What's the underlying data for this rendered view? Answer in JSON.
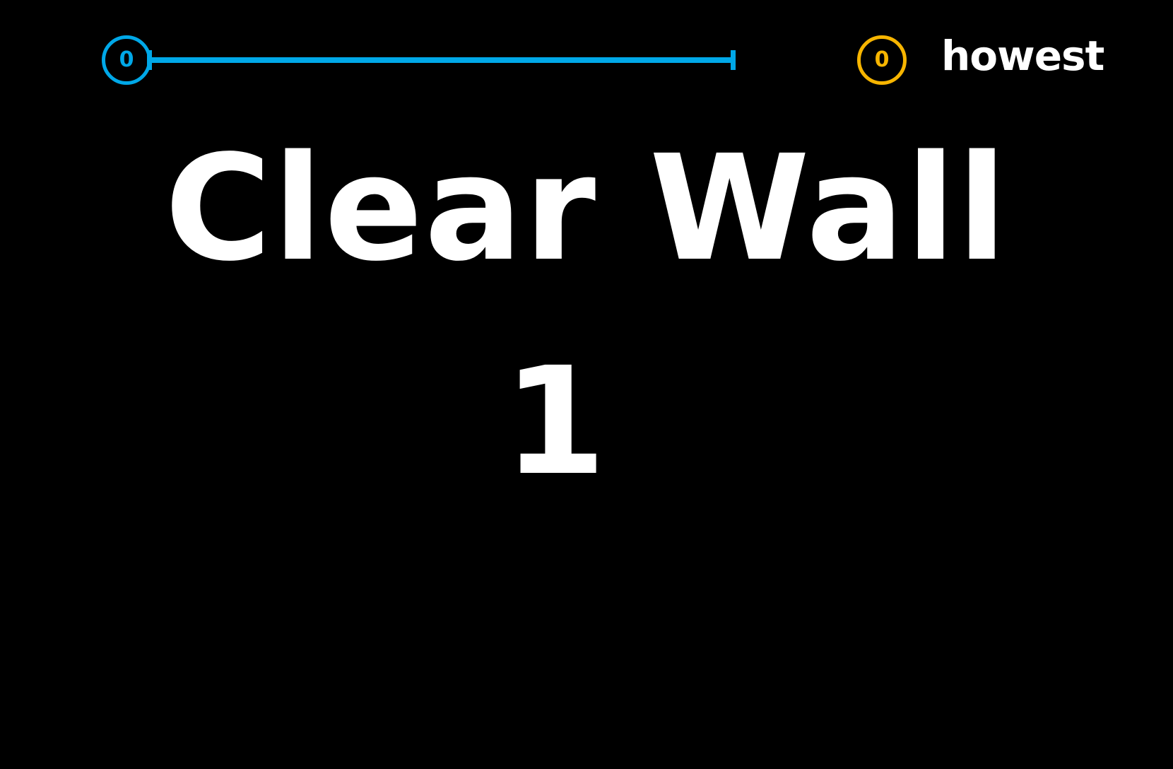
{
  "hud": {
    "player1_score": "0",
    "player2_score": "0",
    "brand": "howest",
    "timer_remaining": 1.0
  },
  "colors": {
    "background": "#000000",
    "player1": "#00a8e8",
    "player2": "#f7b500",
    "text": "#ffffff"
  },
  "game": {
    "title": "Clear Wall",
    "countdown": "1"
  }
}
